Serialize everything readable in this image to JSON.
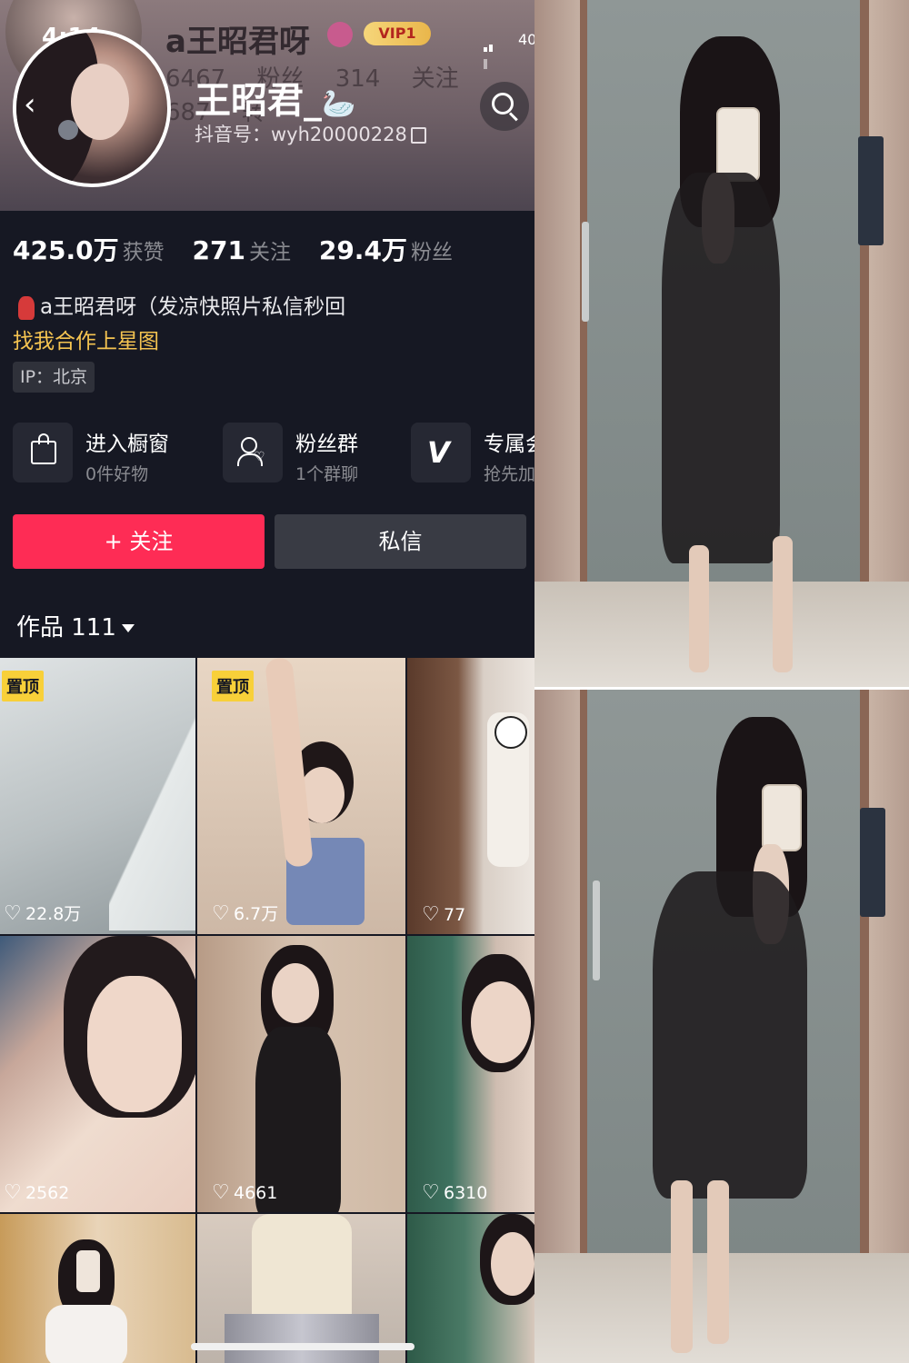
{
  "status_bar": {
    "time": "4:14",
    "battery": "40"
  },
  "header": {
    "bg_name": "a王昭君呀",
    "bg_vip": "VIP1",
    "bg_stats": "6467 粉丝   314 关注   687 转",
    "name": "王昭君_",
    "name_emoji": "🦢",
    "douyin_id": "抖音号：wyh20000228"
  },
  "stats": [
    {
      "num": "425.0万",
      "label": "获赞"
    },
    {
      "num": "271",
      "label": "关注"
    },
    {
      "num": "29.4万",
      "label": "粉丝"
    }
  ],
  "bio": {
    "line1": "a王昭君呀（发凉快照片私信秒回",
    "line2": "找我合作上星图"
  },
  "ip": "IP：北京",
  "features": [
    {
      "title": "进入橱窗",
      "sub": "0件好物",
      "icon": "shopping-bag-icon"
    },
    {
      "title": "粉丝群",
      "sub": "1个群聊",
      "icon": "fan-group-icon"
    },
    {
      "title": "专属会",
      "sub": "抢先加",
      "icon": "v-member-icon"
    }
  ],
  "buttons": {
    "follow": "+ 关注",
    "message": "私信"
  },
  "colors": {
    "follow": "#fe2c55",
    "pin": "#f8d039",
    "link": "#f5c451",
    "background": "#161823"
  },
  "works": {
    "label": "作品 111"
  },
  "videos": [
    {
      "pinned": true,
      "pin_label": "置顶",
      "likes": "22.8万"
    },
    {
      "pinned": true,
      "pin_label": "置顶",
      "likes": "6.7万"
    },
    {
      "pinned": false,
      "likes": "77"
    },
    {
      "pinned": false,
      "likes": "2562"
    },
    {
      "pinned": false,
      "likes": "4661"
    },
    {
      "pinned": false,
      "likes": "6310"
    },
    {
      "pinned": false,
      "likes": ""
    },
    {
      "pinned": false,
      "likes": ""
    },
    {
      "pinned": false,
      "likes": ""
    }
  ]
}
